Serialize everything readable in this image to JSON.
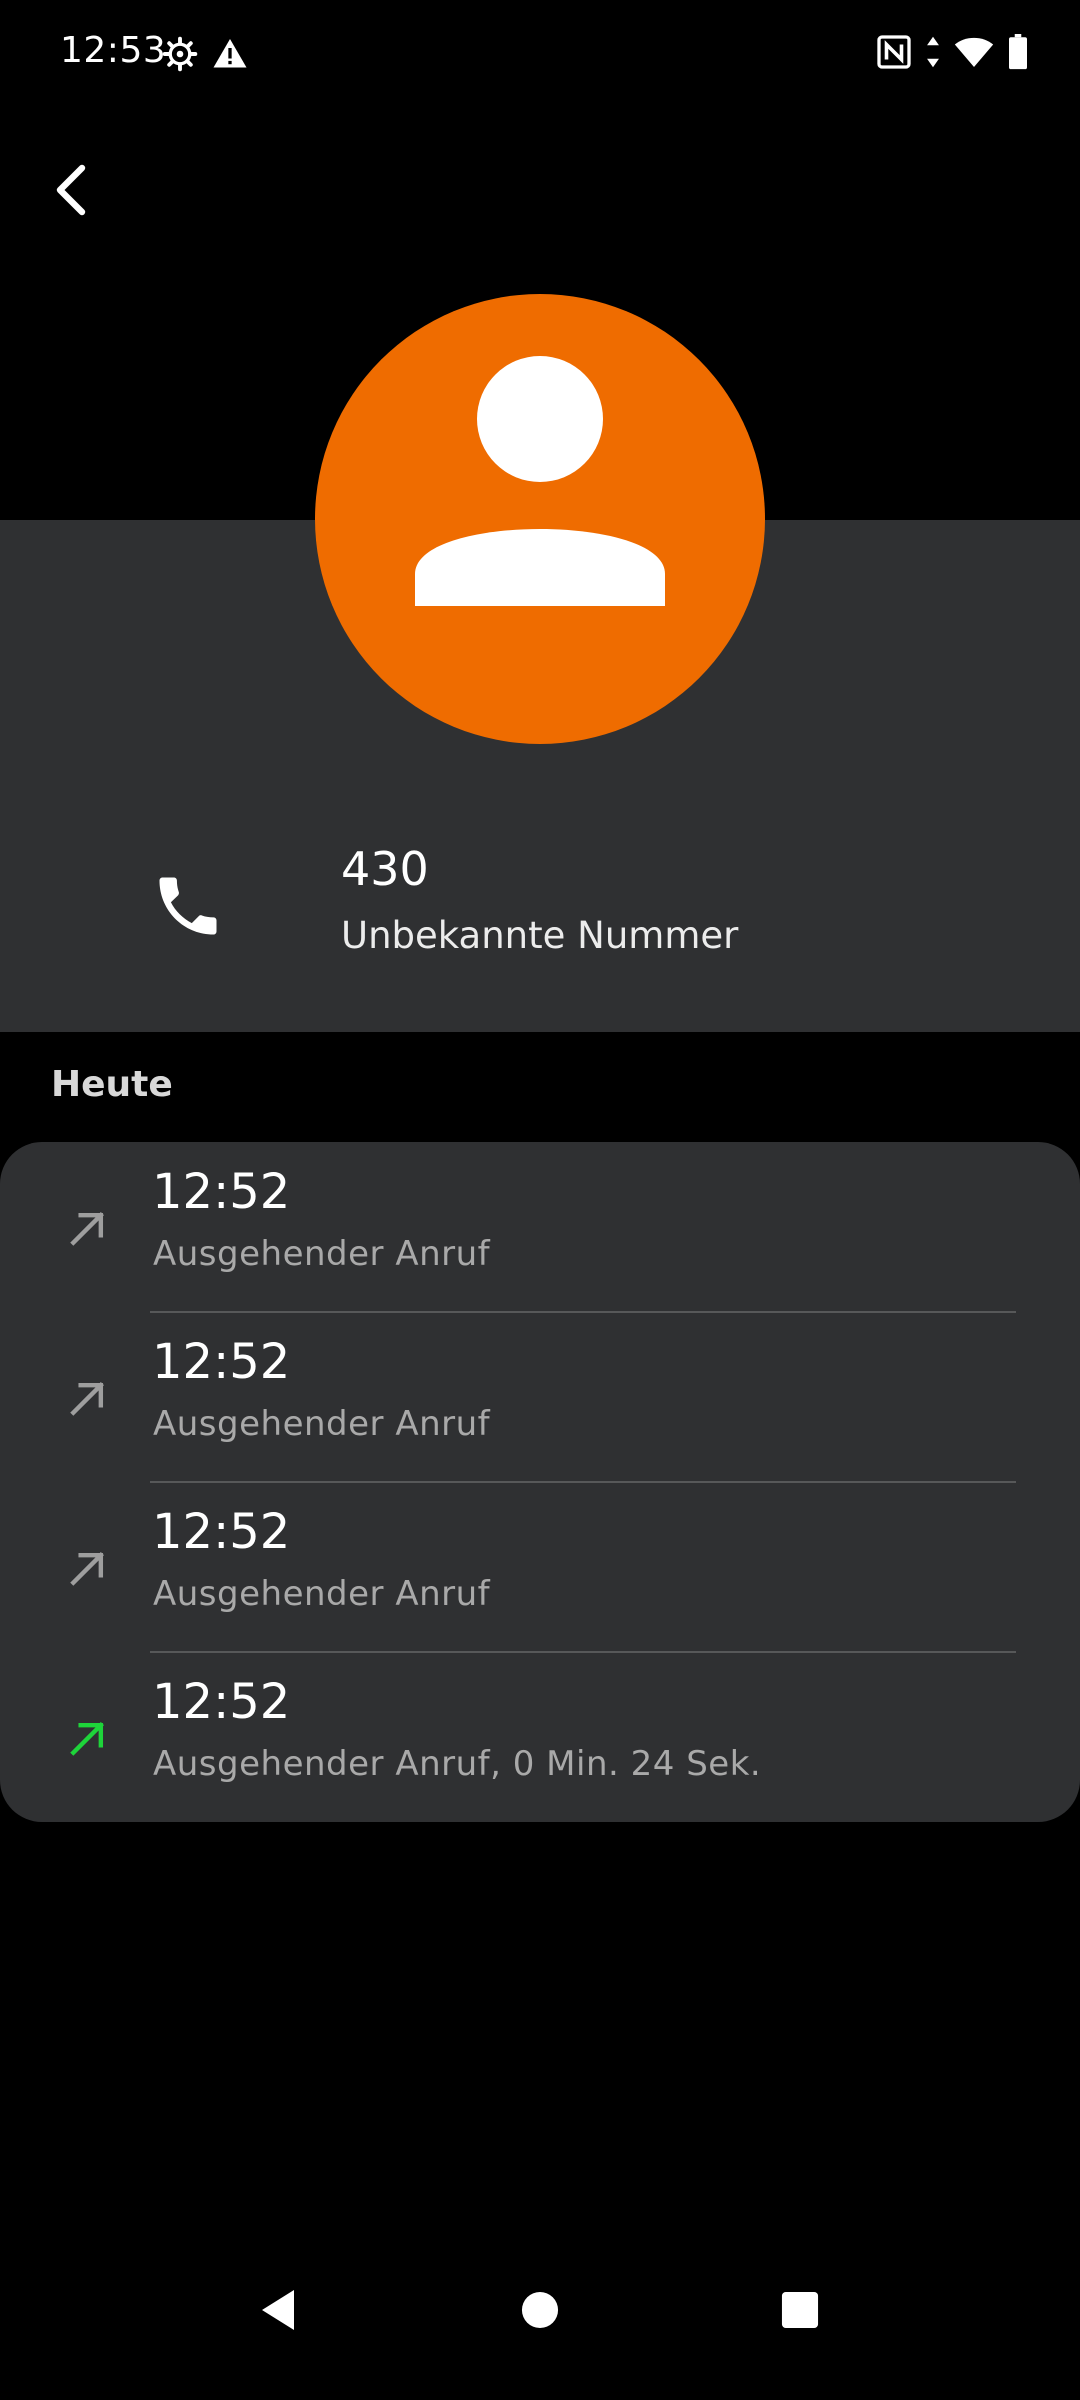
{
  "status_bar": {
    "time": "12:53",
    "left_icons": [
      "settings-gear-icon",
      "warning-icon"
    ],
    "right_icons": [
      "nfc-icon",
      "wifi-icon",
      "battery-icon"
    ]
  },
  "header": {
    "back_icon": "chevron-left-icon",
    "avatar_color": "#ef6c00",
    "contact": {
      "number": "430",
      "label": "Unbekannte Nummer",
      "icon": "phone-icon"
    }
  },
  "history": {
    "section_label": "Heute",
    "calls": [
      {
        "time": "12:52",
        "description": "Ausgehender Anruf",
        "icon": "outgoing-arrow-icon",
        "color": "#9e9e9e"
      },
      {
        "time": "12:52",
        "description": "Ausgehender Anruf",
        "icon": "outgoing-arrow-icon",
        "color": "#9e9e9e"
      },
      {
        "time": "12:52",
        "description": "Ausgehender Anruf",
        "icon": "outgoing-arrow-icon",
        "color": "#9e9e9e"
      },
      {
        "time": "12:52",
        "description": "Ausgehender Anruf, 0 Min. 24 Sek.",
        "icon": "outgoing-arrow-icon",
        "color": "#1ed43a"
      }
    ]
  },
  "nav": {
    "icons": [
      "back-triangle-icon",
      "home-circle-icon",
      "recents-square-icon"
    ]
  }
}
